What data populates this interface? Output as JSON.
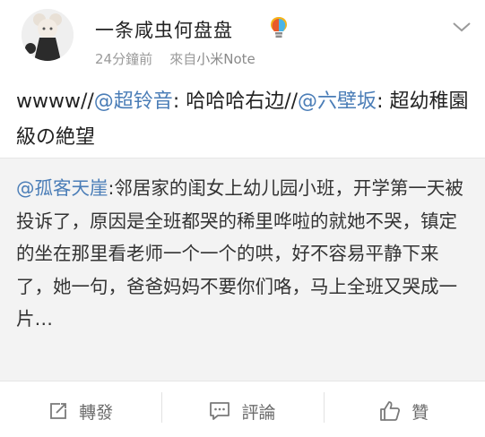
{
  "header": {
    "username": "一条咸虫何盘盘",
    "time": "24分鐘前",
    "source_prefix": "來自",
    "source": "小米Note"
  },
  "post": {
    "text_1": "wwww//",
    "mention_1": "@超铃音",
    "text_2": ": 哈哈哈右边//",
    "mention_2": "@六壁坂",
    "text_3": ": 超幼稚園級の絶望"
  },
  "repost": {
    "mention": "@孤客天崖",
    "text": ":邻居家的闺女上幼儿园小班，开学第一天被投诉了，原因是全班都哭的稀里哗啦的就她不哭，镇定的坐在那里看老师一个一个的哄，好不容易平静下来了，她一句，爸爸妈妈不要你们咯，马上全班又哭成一片…"
  },
  "actions": {
    "repost_label": "轉發",
    "comment_label": "評論",
    "like_label": "贊"
  },
  "colors": {
    "mention": "#4a7db7",
    "meta": "#9a9a9a",
    "repost_bg": "#f3f3f3"
  }
}
